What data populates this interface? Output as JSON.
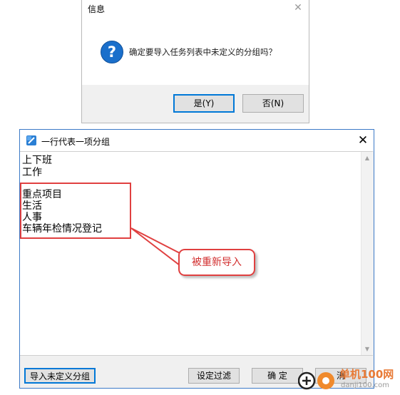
{
  "message_box": {
    "title": "信息",
    "close_glyph": "✕",
    "icon": "question-icon",
    "icon_glyph": "?",
    "message": "确定要导入任务列表中未定义的分组吗？",
    "yes_label": "是(Y)",
    "no_label": "否(N)"
  },
  "group_window": {
    "title": "一行代表一项分组",
    "close_glyph": "✕",
    "lines": [
      "上下班",
      "工作",
      "",
      "重点项目",
      "生活",
      "人事",
      "车辆年检情况登记"
    ],
    "buttons": {
      "import_undefined": "导入未定义分组",
      "filter_settings": "设定过滤",
      "ok": "确  定",
      "cancel": "消"
    }
  },
  "annotation": {
    "callout_text": "被重新导入",
    "color": "#e04040"
  },
  "watermark": {
    "site_cn": "单机100网",
    "site_en": "danji100.com"
  },
  "colors": {
    "accent": "#0078d7",
    "annotation": "#e04040",
    "dialog_bg": "#f0f0f0"
  }
}
